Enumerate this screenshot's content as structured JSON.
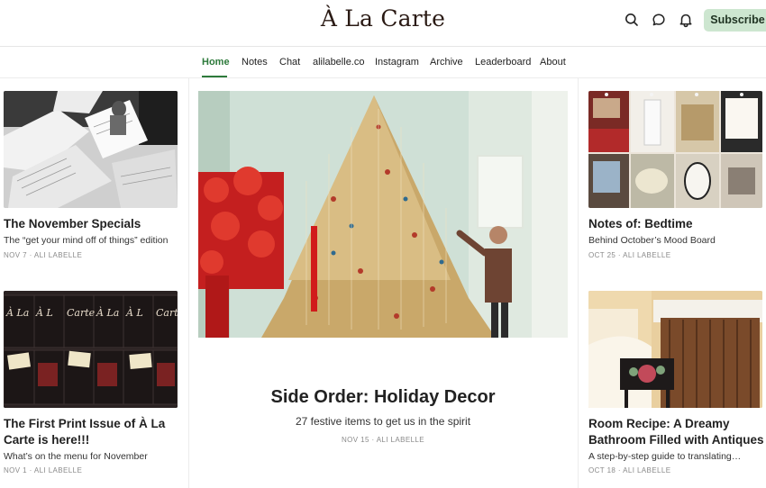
{
  "header": {
    "logo": "À La Carte",
    "subscribe_label": "Subscribe",
    "icons": [
      "search-icon",
      "chat-bubble-icon",
      "bell-icon"
    ]
  },
  "nav": {
    "items": [
      "Home",
      "Notes",
      "Chat",
      "alilabelle.co",
      "Instagram",
      "Archive",
      "Leaderboard",
      "About"
    ],
    "active": "Home"
  },
  "posts": {
    "left": [
      {
        "title": "The November Specials",
        "subtitle": "The “get your mind off of things” edition",
        "meta": "NOV 7 · ALI LABELLE"
      },
      {
        "title": "The First Print Issue of À La Carte is here!!!",
        "subtitle": "What’s on the menu for November",
        "meta": "NOV 1 · ALI LABELLE"
      }
    ],
    "feature": {
      "title": "Side Order: Holiday Decor",
      "subtitle": "27 festive items to get us in the spirit",
      "meta": "NOV 15 · ALI LABELLE"
    },
    "right": [
      {
        "title": "Notes of: Bedtime",
        "subtitle": "Behind October’s Mood Board",
        "meta": "OCT 25 · ALI LABELLE"
      },
      {
        "title": "Room Recipe: A Dreamy Bathroom Filled with Antiques",
        "subtitle": "A step-by-step guide to translating…",
        "meta": "OCT 18 · ALI LABELLE"
      }
    ]
  },
  "colors": {
    "accent": "#2d7a3b",
    "subscribe_bg": "#cde6d0",
    "divider": "#ececec"
  }
}
